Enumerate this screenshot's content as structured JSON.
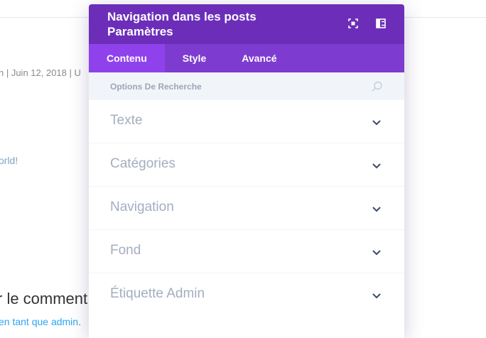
{
  "background": {
    "meta_text": "n | Juin 12, 2018 | U",
    "link_text": "orld!",
    "comment_heading": "r le comment",
    "login_text": "en tant que admin",
    "login_suffix": "."
  },
  "modal": {
    "title": "Navigation dans les posts Paramètres",
    "header_icons": [
      "expand-icon",
      "split-view-icon"
    ],
    "colors": {
      "header": "#6c2eb9",
      "tabs": "#7e3bd0",
      "active_tab": "#8f42ec"
    },
    "tabs": [
      {
        "label": "Contenu",
        "active": true
      },
      {
        "label": "Style",
        "active": false
      },
      {
        "label": "Avancé",
        "active": false
      }
    ],
    "search": {
      "placeholder": "Options De Recherche"
    },
    "sections": [
      {
        "label": "Texte"
      },
      {
        "label": "Catégories"
      },
      {
        "label": "Navigation"
      },
      {
        "label": "Fond"
      },
      {
        "label": "Étiquette Admin"
      }
    ]
  }
}
